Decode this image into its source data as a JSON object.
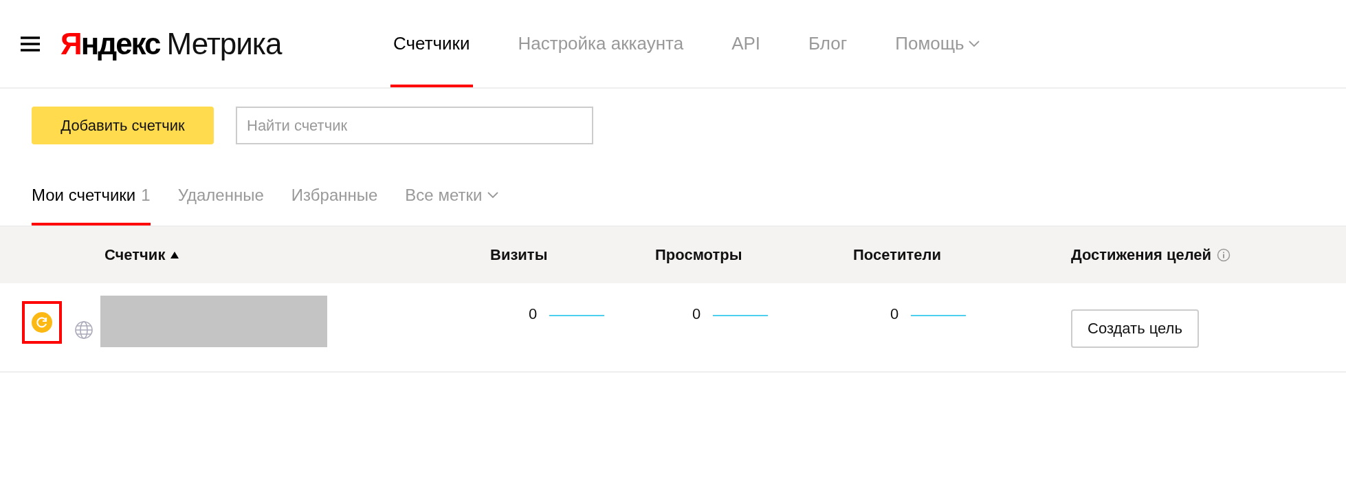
{
  "logo": {
    "brand": "Яндекс",
    "product": "Метрика"
  },
  "nav": [
    {
      "label": "Счетчики",
      "selected": true,
      "dropdown": false
    },
    {
      "label": "Настройка аккаунта",
      "selected": false,
      "dropdown": false
    },
    {
      "label": "API",
      "selected": false,
      "dropdown": false
    },
    {
      "label": "Блог",
      "selected": false,
      "dropdown": false
    },
    {
      "label": "Помощь",
      "selected": false,
      "dropdown": true
    }
  ],
  "add_button": "Добавить счетчик",
  "search": {
    "placeholder": "Найти счетчик"
  },
  "filter_tabs": [
    {
      "label": "Мои счетчики",
      "count": "1",
      "selected": true,
      "dropdown": false
    },
    {
      "label": "Удаленные",
      "selected": false,
      "dropdown": false
    },
    {
      "label": "Избранные",
      "selected": false,
      "dropdown": false
    },
    {
      "label": "Все метки",
      "selected": false,
      "dropdown": true
    }
  ],
  "table": {
    "columns": [
      {
        "label": "Счетчик",
        "sorted": true,
        "info": false
      },
      {
        "label": "Визиты",
        "sorted": false,
        "info": false
      },
      {
        "label": "Просмотры",
        "sorted": false,
        "info": false
      },
      {
        "label": "Посетители",
        "sorted": false,
        "info": false
      },
      {
        "label": "Достижения целей",
        "sorted": false,
        "info": true
      }
    ],
    "rows": [
      {
        "highlighted": true,
        "values": [
          "0",
          "0",
          "0"
        ],
        "action": "Создать цель"
      }
    ]
  }
}
